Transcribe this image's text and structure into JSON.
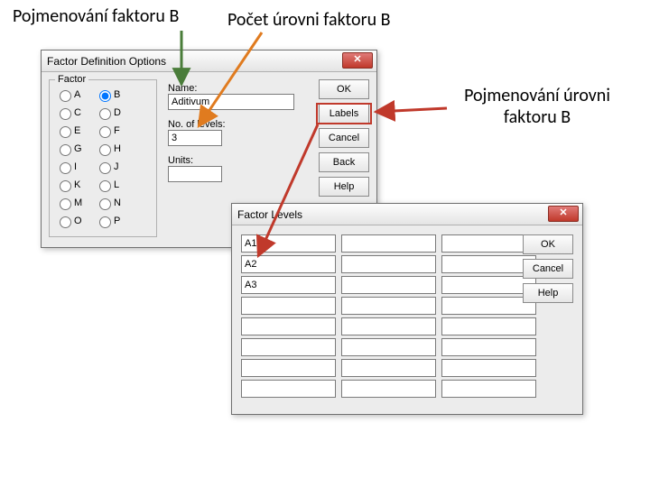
{
  "annotations": {
    "name_factor_b": "Pojmenování faktoru B",
    "count_levels_b": "Počet úrovni faktoru B",
    "name_levels_b": "Pojmenování úrovni faktoru B"
  },
  "dialog1": {
    "title": "Factor Definition Options",
    "group_label": "Factor",
    "factors": [
      "A",
      "B",
      "C",
      "D",
      "E",
      "F",
      "G",
      "H",
      "I",
      "J",
      "K",
      "L",
      "M",
      "N",
      "O",
      "P"
    ],
    "selected_factor": "B",
    "name_label": "Name:",
    "name_value": "Aditivum",
    "levels_label": "No. of levels:",
    "levels_value": "3",
    "units_label": "Units:",
    "units_value": "",
    "buttons": {
      "ok": "OK",
      "labels": "Labels",
      "cancel": "Cancel",
      "back": "Back",
      "help": "Help"
    }
  },
  "dialog2": {
    "title": "Factor Levels",
    "cells": [
      "A1",
      "A2",
      "A3",
      "",
      "",
      "",
      "",
      "",
      "",
      "",
      "",
      "",
      "",
      "",
      "",
      "",
      "",
      "",
      "",
      "",
      "",
      "",
      "",
      ""
    ],
    "buttons": {
      "ok": "OK",
      "cancel": "Cancel",
      "help": "Help"
    }
  }
}
